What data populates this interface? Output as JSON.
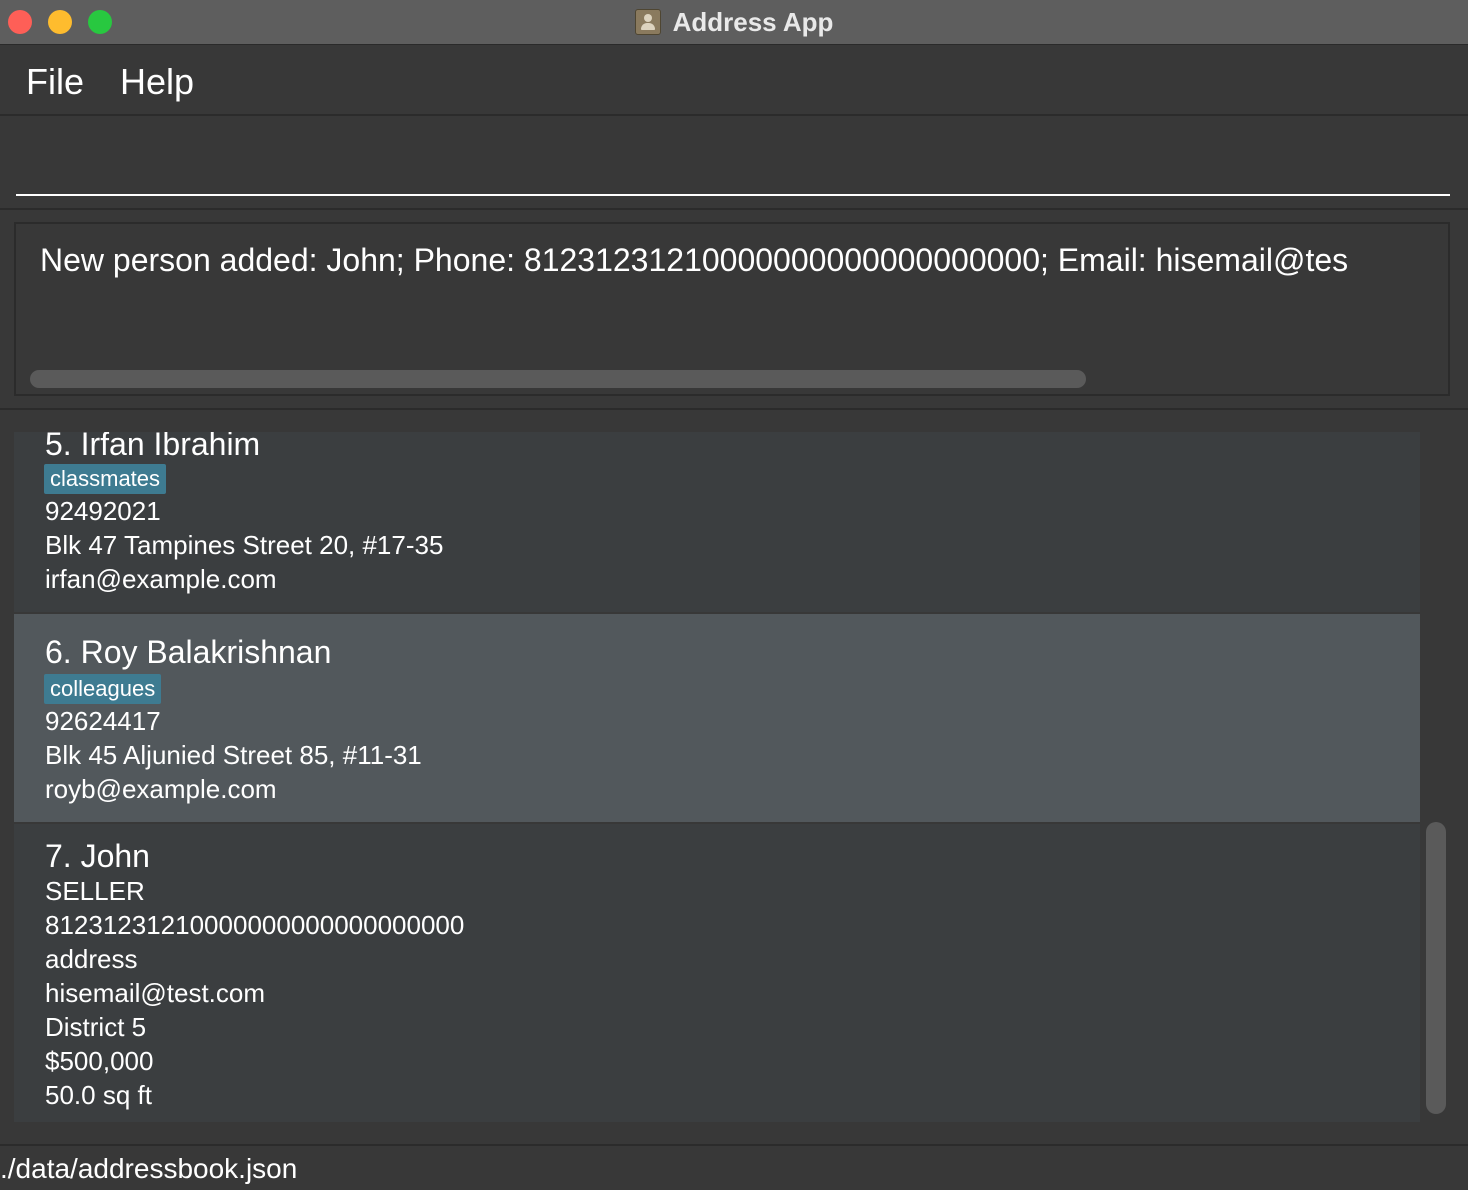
{
  "window": {
    "title": "Address App"
  },
  "menu": {
    "file": "File",
    "help": "Help"
  },
  "command": {
    "value": "",
    "placeholder": ""
  },
  "result": {
    "text": "New person added: John; Phone: 81231231210000000000000000000; Email: hisemail@tes"
  },
  "persons": [
    {
      "name": "5. Irfan Ibrahim",
      "tag": "classmates",
      "phone": "92492021",
      "address": "Blk 47 Tampines Street 20, #17-35",
      "email": "irfan@example.com"
    },
    {
      "name": "6. Roy Balakrishnan",
      "tag": "colleagues",
      "phone": "92624417",
      "address": "Blk 45 Aljunied Street 85, #11-31",
      "email": "royb@example.com"
    },
    {
      "name": "7. John",
      "role": "SELLER",
      "phone": "81231231210000000000000000000",
      "address": "address",
      "email": "hisemail@test.com",
      "district": "District 5",
      "price": "$500,000",
      "size": "50.0 sq ft"
    }
  ],
  "status": {
    "path": "./data/addressbook.json"
  },
  "colors": {
    "background": "#383838",
    "card": "#3b3e40",
    "card_selected": "#52585c",
    "tag": "#3e7b91",
    "titlebar": "#5e5e5e"
  }
}
